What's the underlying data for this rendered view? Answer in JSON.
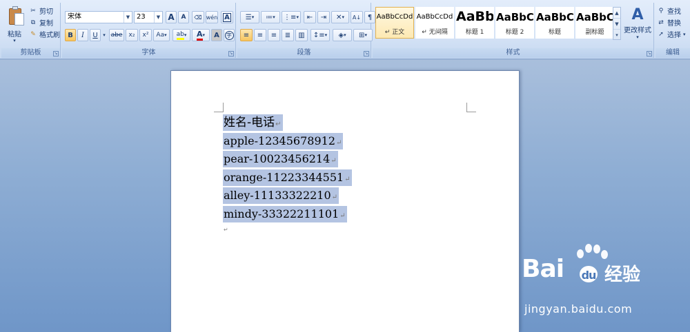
{
  "ribbon": {
    "clipboard": {
      "label": "剪贴板",
      "paste": "粘贴",
      "cut": "剪切",
      "copy": "复制",
      "format_painter": "格式刷"
    },
    "font": {
      "label": "字体",
      "font_name": "宋体",
      "font_size": "23",
      "grow": "A",
      "shrink": "A",
      "phonetic": "wén",
      "bold": "B",
      "italic": "I",
      "underline": "U",
      "strike": "abe",
      "subscript": "x₂",
      "superscript": "x²",
      "change_case": "Aa",
      "char_border": "A",
      "char_shading": "A",
      "enclose": "字"
    },
    "paragraph": {
      "label": "段落"
    },
    "styles": {
      "label": "样式",
      "items": [
        {
          "sample": "AaBbCcDd",
          "name": "↵ 正文"
        },
        {
          "sample": "AaBbCcDd",
          "name": "↵ 无间隔"
        },
        {
          "sample": "AaBb",
          "name": "标题 1"
        },
        {
          "sample": "AaBbC",
          "name": "标题 2"
        },
        {
          "sample": "AaBbC",
          "name": "标题"
        },
        {
          "sample": "AaBbC",
          "name": "副标题"
        }
      ],
      "change_styles": "更改样式"
    },
    "editing": {
      "label": "编辑",
      "find": "查找",
      "replace": "替换",
      "select": "选择"
    }
  },
  "document": {
    "lines": [
      "姓名-电话",
      "apple-12345678912",
      "pear-10023456214",
      "orange-11223344551",
      "alley-11133322210",
      "mindy-33322211101"
    ],
    "paragraph_mark": "↵"
  },
  "watermark": {
    "brand": "Bai",
    "brand_tail": "经验",
    "url": "jingyan.baidu.com"
  },
  "colors": {
    "selection": "#b4c4e2",
    "ribbon_bg": "#d5e3f6",
    "workspace_bg": "#8faed4",
    "highlight_yellow": "#ffff00",
    "font_color_red": "#e00000"
  }
}
